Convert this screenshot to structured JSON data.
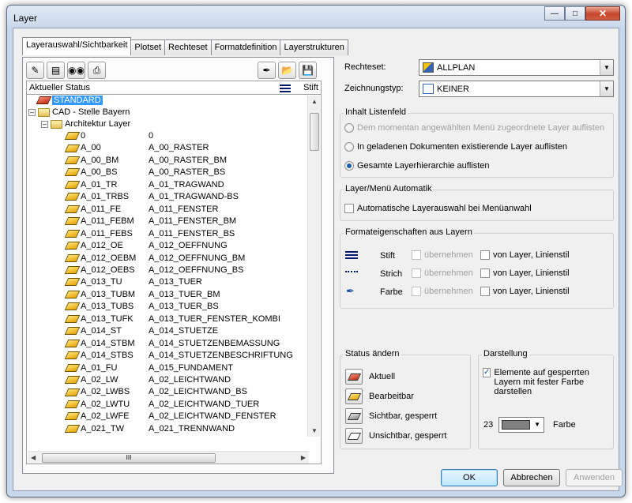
{
  "window": {
    "title": "Layer"
  },
  "tabs": [
    "Layerauswahl/Sichtbarkeit",
    "Plotset",
    "Rechteset",
    "Formatdefinition",
    "Layerstrukturen"
  ],
  "tree_header": {
    "status": "Aktueller Status",
    "stift": "Stift"
  },
  "tree": {
    "standard": "STANDARD",
    "cad": "CAD - Stelle Bayern",
    "arch": "Architektur Layer",
    "layers": [
      {
        "name": "0",
        "desc": "0"
      },
      {
        "name": "A_00",
        "desc": "A_00_RASTER"
      },
      {
        "name": "A_00_BM",
        "desc": "A_00_RASTER_BM"
      },
      {
        "name": "A_00_BS",
        "desc": "A_00_RASTER_BS"
      },
      {
        "name": "A_01_TR",
        "desc": "A_01_TRAGWAND"
      },
      {
        "name": "A_01_TRBS",
        "desc": "A_01_TRAGWAND-BS"
      },
      {
        "name": "A_011_FE",
        "desc": "A_011_FENSTER"
      },
      {
        "name": "A_011_FEBM",
        "desc": "A_011_FENSTER_BM"
      },
      {
        "name": "A_011_FEBS",
        "desc": "A_011_FENSTER_BS"
      },
      {
        "name": "A_012_OE",
        "desc": "A_012_OEFFNUNG"
      },
      {
        "name": "A_012_OEBM",
        "desc": "A_012_OEFFNUNG_BM"
      },
      {
        "name": "A_012_OEBS",
        "desc": "A_012_OEFFNUNG_BS"
      },
      {
        "name": "A_013_TU",
        "desc": "A_013_TUER"
      },
      {
        "name": "A_013_TUBM",
        "desc": "A_013_TUER_BM"
      },
      {
        "name": "A_013_TUBS",
        "desc": "A_013_TUER_BS"
      },
      {
        "name": "A_013_TUFK",
        "desc": "A_013_TUER_FENSTER_KOMBI"
      },
      {
        "name": "A_014_ST",
        "desc": "A_014_STUETZE"
      },
      {
        "name": "A_014_STBM",
        "desc": "A_014_STUETZENBEMASSUNG"
      },
      {
        "name": "A_014_STBS",
        "desc": "A_014_STUETZENBESCHRIFTUNG"
      },
      {
        "name": "A_01_FU",
        "desc": "A_015_FUNDAMENT"
      },
      {
        "name": "A_02_LW",
        "desc": "A_02_LEICHTWAND"
      },
      {
        "name": "A_02_LWBS",
        "desc": "A_02_LEICHTWAND_BS"
      },
      {
        "name": "A_02_LWTU",
        "desc": "A_02_LEICHTWAND_TUER"
      },
      {
        "name": "A_02_LWFE",
        "desc": "A_02_LEICHTWAND_FENSTER"
      },
      {
        "name": "A_021_TW",
        "desc": "A_021_TRENNWAND"
      }
    ],
    "hscroll_grip": "III"
  },
  "rechteset": {
    "label": "Rechteset:",
    "value": "ALLPLAN"
  },
  "zeichnungstyp": {
    "label": "Zeichnungstyp:",
    "value": "KEINER"
  },
  "inhalt": {
    "title": "Inhalt Listenfeld",
    "opt1": "Dem momentan angewählten Menü zugeordnete Layer auflisten",
    "opt2": "In geladenen Dokumenten existierende Layer auflisten",
    "opt3": "Gesamte Layerhierarchie auflisten"
  },
  "automatik": {
    "title": "Layer/Menü Automatik",
    "check": "Automatische Layerauswahl bei Menüanwahl"
  },
  "format": {
    "title": "Formateigenschaften aus Layern",
    "rows": [
      {
        "label": "Stift",
        "take": "übernehmen",
        "from": "von Layer, Linienstil"
      },
      {
        "label": "Strich",
        "take": "übernehmen",
        "from": "von Layer, Linienstil"
      },
      {
        "label": "Farbe",
        "take": "übernehmen",
        "from": "von Layer, Linienstil"
      }
    ]
  },
  "status": {
    "title": "Status ändern",
    "aktuell": "Aktuell",
    "bearbeitbar": "Bearbeitbar",
    "sichtbar": "Sichtbar, gesperrt",
    "unsichtbar": "Unsichtbar, gesperrt"
  },
  "darstellung": {
    "title": "Darstellung",
    "check": "Elemente auf gesperrten Layern mit fester Farbe darstellen",
    "color_num": "23",
    "farbe": "Farbe"
  },
  "buttons": {
    "ok": "OK",
    "cancel": "Abbrechen",
    "apply": "Anwenden"
  },
  "colors": {
    "selection": "#3399ff",
    "layer_yellow": "#f5c400",
    "standard_red": "#d03a1e"
  }
}
